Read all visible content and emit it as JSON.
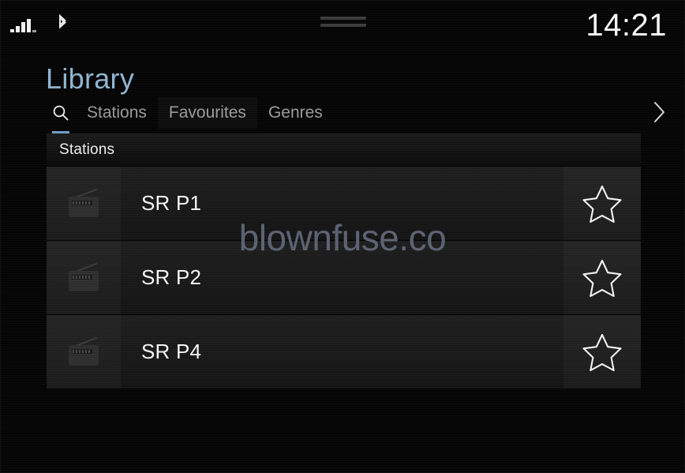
{
  "statusbar": {
    "signal_icon": "signal-bars-icon",
    "signal_bars_total": 5,
    "signal_bars_active": 4,
    "bluetooth_icon": "bluetooth-icon",
    "drag_handle_icon": "drag-handle-icon",
    "clock": "14:21"
  },
  "header": {
    "title": "Library",
    "chevron_right_icon": "chevron-right-icon"
  },
  "tabs": [
    {
      "label": "",
      "icon": "search-icon",
      "active": true,
      "boxed": false
    },
    {
      "label": "Stations",
      "icon": "",
      "active": false,
      "boxed": false
    },
    {
      "label": "Favourites",
      "icon": "",
      "active": false,
      "boxed": true
    },
    {
      "label": "Genres",
      "icon": "",
      "active": false,
      "boxed": false
    }
  ],
  "list": {
    "section_title": "Stations",
    "rows": [
      {
        "icon": "radio-icon",
        "name": "SR P1",
        "favourite_icon": "star-outline-icon",
        "favourite": false
      },
      {
        "icon": "radio-icon",
        "name": "SR P2",
        "favourite_icon": "star-outline-icon",
        "favourite": false
      },
      {
        "icon": "radio-icon",
        "name": "SR P4",
        "favourite_icon": "star-outline-icon",
        "favourite": false
      }
    ]
  },
  "watermark": {
    "text": "blownfuse.co"
  },
  "colors": {
    "background": "#050505",
    "title_blue": "#8fb4d0",
    "accent_underline": "#6f9dc4",
    "text_primary": "#f4f4f4",
    "text_secondary": "#9b9b9b",
    "row_background": "#1a1a1a",
    "watermark": "#5b6272"
  }
}
